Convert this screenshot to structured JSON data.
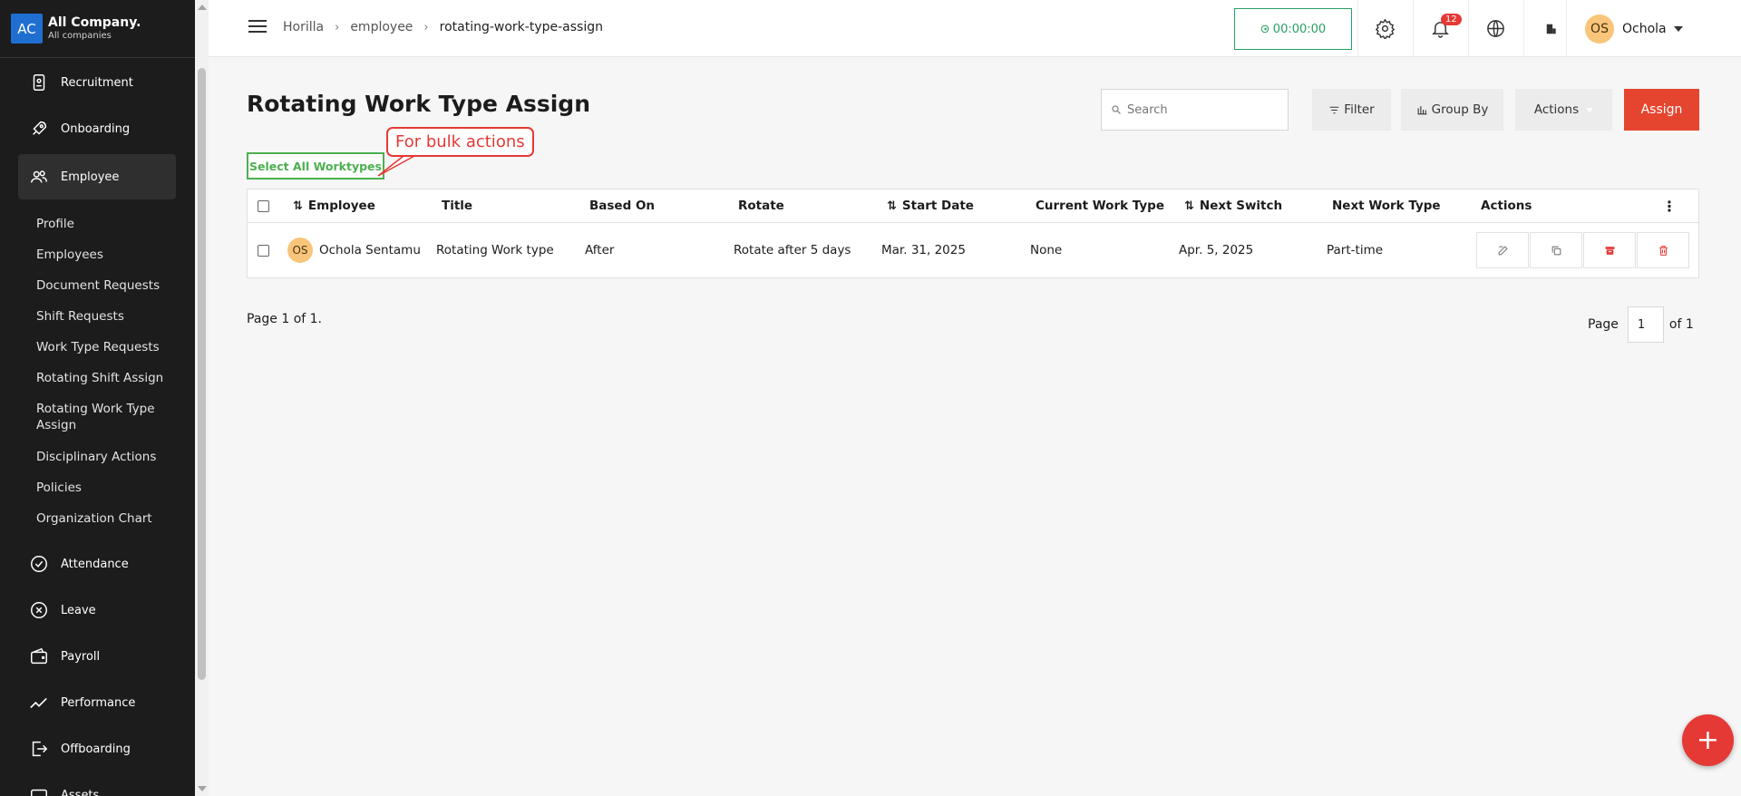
{
  "company": {
    "initials": "AC",
    "name": "All Company.",
    "subtitle": "All companies"
  },
  "sidebar": {
    "items": [
      {
        "label": "Recruitment",
        "icon": "recruitment-icon"
      },
      {
        "label": "Onboarding",
        "icon": "rocket-icon"
      },
      {
        "label": "Employee",
        "icon": "people-icon"
      },
      {
        "label": "Attendance",
        "icon": "check-circle-icon"
      },
      {
        "label": "Leave",
        "icon": "x-circle-icon"
      },
      {
        "label": "Payroll",
        "icon": "wallet-icon"
      },
      {
        "label": "Performance",
        "icon": "trend-icon"
      },
      {
        "label": "Offboarding",
        "icon": "exit-icon"
      },
      {
        "label": "Assets",
        "icon": "assets-icon"
      }
    ],
    "employee_sub": [
      "Profile",
      "Employees",
      "Document Requests",
      "Shift Requests",
      "Work Type Requests",
      "Rotating Shift Assign",
      "Rotating Work Type Assign",
      "Disciplinary Actions",
      "Policies",
      "Organization Chart"
    ]
  },
  "header": {
    "breadcrumb": [
      "Horilla",
      "employee",
      "rotating-work-type-assign"
    ],
    "timer": "00:00:00",
    "notification_count": "12",
    "user_initials": "OS",
    "user_name": "Ochola"
  },
  "main": {
    "title": "Rotating Work Type Assign",
    "search_placeholder": "Search",
    "filter_label": "Filter",
    "groupby_label": "Group By",
    "actions_label": "Actions",
    "assign_label": "Assign",
    "select_all_label": "Select All Worktypes",
    "annotation": "For bulk actions"
  },
  "table": {
    "columns": [
      "Employee",
      "Title",
      "Based On",
      "Rotate",
      "Start Date",
      "Current Work Type",
      "Next Switch",
      "Next Work Type",
      "Actions"
    ],
    "rows": [
      {
        "avatar": "OS",
        "employee": "Ochola Sentamu",
        "title": "Rotating Work type",
        "based_on": "After",
        "rotate": "Rotate after 5 days",
        "start_date": "Mar. 31, 2025",
        "current_work_type": "None",
        "next_switch": "Apr. 5, 2025",
        "next_work_type": "Part-time"
      }
    ]
  },
  "pagination": {
    "info": "Page 1 of 1.",
    "page_label": "Page",
    "page_value": "1",
    "of_label": "of 1"
  },
  "colors": {
    "sidebar_bg": "#1c1c1c",
    "accent_red": "#e5452e",
    "green": "#27a062",
    "avatar": "#f8c57a"
  }
}
